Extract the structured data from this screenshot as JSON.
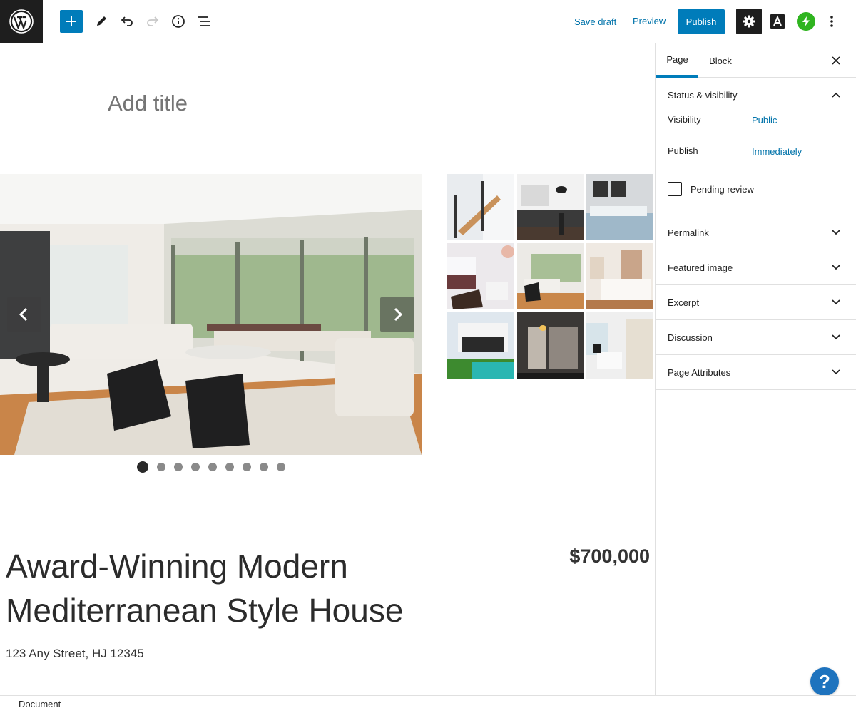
{
  "toolbar": {
    "save_draft": "Save draft",
    "preview": "Preview",
    "publish": "Publish",
    "accent": "#007cba"
  },
  "editor": {
    "title_placeholder": "Add title",
    "slider": {
      "slide_count": 9,
      "active_slide": 1
    },
    "listing": {
      "title": "Award-Winning Modern Mediterranean Style House",
      "price": "$700,000",
      "address": "123 Any Street, HJ 12345"
    }
  },
  "sidebar": {
    "tabs": [
      "Page",
      "Block"
    ],
    "status": {
      "title": "Status & visibility",
      "visibility_label": "Visibility",
      "visibility_value": "Public",
      "publish_label": "Publish",
      "publish_value": "Immediately",
      "pending_review": "Pending review"
    },
    "panels": [
      "Permalink",
      "Featured image",
      "Excerpt",
      "Discussion",
      "Page Attributes"
    ]
  },
  "footer": {
    "breadcrumb": "Document"
  },
  "help": {
    "label": "?"
  }
}
